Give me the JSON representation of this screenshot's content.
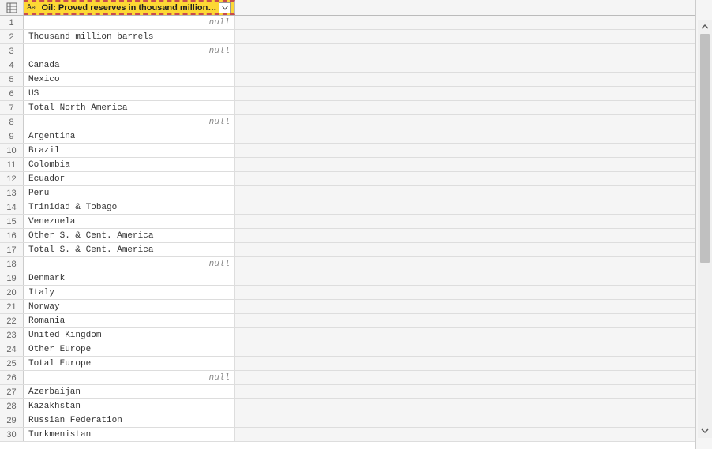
{
  "column": {
    "type_label": "ABC",
    "header": "Oil: Proved reserves in thousand million barrels"
  },
  "null_text": "null",
  "rows": [
    {
      "n": "1",
      "v": "null",
      "null": true
    },
    {
      "n": "2",
      "v": "Thousand million barrels",
      "null": false
    },
    {
      "n": "3",
      "v": "null",
      "null": true
    },
    {
      "n": "4",
      "v": "Canada",
      "null": false
    },
    {
      "n": "5",
      "v": "Mexico",
      "null": false
    },
    {
      "n": "6",
      "v": "US",
      "null": false
    },
    {
      "n": "7",
      "v": "Total North America",
      "null": false
    },
    {
      "n": "8",
      "v": "null",
      "null": true
    },
    {
      "n": "9",
      "v": "Argentina",
      "null": false
    },
    {
      "n": "10",
      "v": "Brazil",
      "null": false
    },
    {
      "n": "11",
      "v": "Colombia",
      "null": false
    },
    {
      "n": "12",
      "v": "Ecuador",
      "null": false
    },
    {
      "n": "13",
      "v": "Peru",
      "null": false
    },
    {
      "n": "14",
      "v": "Trinidad & Tobago",
      "null": false
    },
    {
      "n": "15",
      "v": "Venezuela",
      "null": false
    },
    {
      "n": "16",
      "v": "Other S. & Cent. America",
      "null": false
    },
    {
      "n": "17",
      "v": "Total S. & Cent. America",
      "null": false
    },
    {
      "n": "18",
      "v": "null",
      "null": true
    },
    {
      "n": "19",
      "v": "Denmark",
      "null": false
    },
    {
      "n": "20",
      "v": "Italy",
      "null": false
    },
    {
      "n": "21",
      "v": "Norway",
      "null": false
    },
    {
      "n": "22",
      "v": "Romania",
      "null": false
    },
    {
      "n": "23",
      "v": "United Kingdom",
      "null": false
    },
    {
      "n": "24",
      "v": "Other Europe",
      "null": false
    },
    {
      "n": "25",
      "v": "Total Europe",
      "null": false
    },
    {
      "n": "26",
      "v": "null",
      "null": true
    },
    {
      "n": "27",
      "v": "Azerbaijan",
      "null": false
    },
    {
      "n": "28",
      "v": "Kazakhstan",
      "null": false
    },
    {
      "n": "29",
      "v": "Russian Federation",
      "null": false
    },
    {
      "n": "30",
      "v": "Turkmenistan",
      "null": false
    }
  ]
}
